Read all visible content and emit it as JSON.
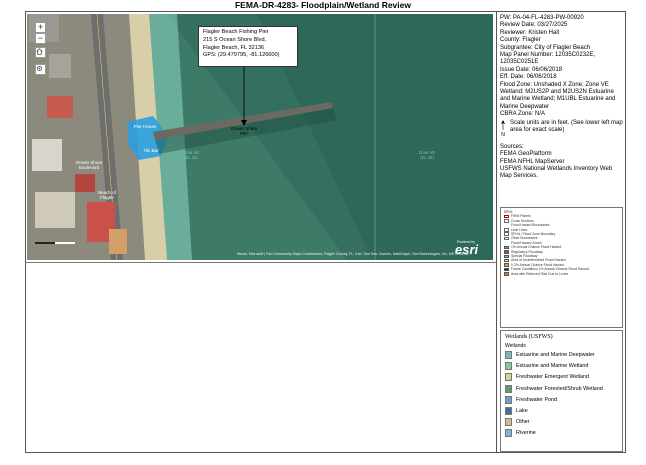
{
  "title": "FEMA-DR-4283- Floodplain/Wetland Review",
  "map": {
    "controls": {
      "zoom_in": "+",
      "zoom_out": "−"
    },
    "callout": {
      "name": "Flagler Beach Fishing Pier",
      "address1": "215 S Ocean Shore Blvd,",
      "address2": "Flagler Beach, FL 32136",
      "gps": "GPS: (29.479795, -81.126600)"
    },
    "labels": {
      "pier_label": "Ocean Shore\nPier",
      "pier_house": "Pier House",
      "tiki": "Tiki Bar",
      "ocean_shore": "Ocean Shore\nBoulevard",
      "beach": "Beach of\nFlagler",
      "zone1": "Zone VE\n(EL 18)",
      "zone2": "Zone VE\n(EL 18)"
    },
    "attribution": "Maxar, Microsoft | Esri Community Maps Contributors, Flagler County, FL, Esri, TomTom, Garmin, SafeGraph, GeoTechnologies, Inc, METI/NASA, USGS, EPA, NPS, US Census Bureau, USDA, USFWS",
    "esri": "esri",
    "powered_by": "Powered by"
  },
  "info": {
    "pw": "PW: PA-04-FL-4283-PW-00920",
    "review_date": "Review Date: 03/27/2025",
    "reviewer": "Reviewer: Kristen Hall",
    "county": "County: Flagler",
    "subgrantee": "Subgrantee: City of Flagler Beach",
    "map_panel": "Map Panel Number: 12035C0232E,",
    "map_panel2": "12035C0251E",
    "issue_date": "Issue Date: 06/06/2018",
    "eff_date": "Eff. Date: 06/06/2018",
    "flood_zone": "Flood Zone: Unshaded X Zone; Zone VE",
    "wetland": "Wetland: M2US2P and M2US2N Estuarine and Marine Wetland; M1UBL Estuarine and Marine Deepwater",
    "cbra": "CBRA Zone: N/A",
    "scale_note": "Scale units are in feet. (See lower left map area for exact scale)",
    "north": "N",
    "sources_head": "Sources:",
    "source1": "FEMA GeoPlatform",
    "source2": "FEMA NFHL MapServer",
    "source3": "USFWS National Wetlands Inventory Web Map Services."
  },
  "legend_nfhl": {
    "title": "NFHL",
    "items": [
      {
        "label": "FIRM Panels",
        "color": "#ffffff",
        "border": "#c00000"
      },
      {
        "label": "Cross Sections",
        "color": "#ffffff",
        "border": "#666666"
      },
      {
        "label": "Flood Hazard Boundaries",
        "color": "#ffffff",
        "border": "#ffffff"
      },
      {
        "label": "Limit Lines",
        "color": "#ffffff",
        "border": "#666666"
      },
      {
        "label": "SFHA / Flood Zone Boundary",
        "color": "#ffffff",
        "border": "#666666"
      },
      {
        "label": "Other Boundaries",
        "color": "#ffffff",
        "border": "#666666"
      },
      {
        "label": "Flood Hazard Zones",
        "color": "#ffffff",
        "border": "#ffffff"
      },
      {
        "label": "1% Annual Chance Flood Hazard",
        "color": "#34a9e1",
        "border": "#555555"
      },
      {
        "label": "Regulatory Floodway",
        "color": "#c0357f",
        "border": "#555555"
      },
      {
        "label": "Special Floodway",
        "color": "#6fb6e8",
        "border": "#555555"
      },
      {
        "label": "Area of Undetermined Flood Hazard",
        "color": "#f3e4a5",
        "border": "#555555"
      },
      {
        "label": "0.2% Annual Chance Flood Hazard",
        "color": "#f29b3d",
        "border": "#555555"
      },
      {
        "label": "Future Conditions 1% Annual Chance Flood Hazard",
        "color": "#2a2a2a",
        "border": "#555555"
      },
      {
        "label": "Area with Reduced Risk Due to Levee",
        "color": "#d9792c",
        "border": "#555555"
      }
    ]
  },
  "legend_wetlands": {
    "title": "Wetlands (USFWS)",
    "subtitle": "Wetlands",
    "items": [
      {
        "label": "Estuarine and Marine Deepwater",
        "color": "#79b8b0"
      },
      {
        "label": "Estuarine and Marine Wetland",
        "color": "#8bc2a8"
      },
      {
        "label": "Freshwater Emergent Wetland",
        "color": "#c4dd86"
      },
      {
        "label": "Freshwater Forested/Shrub Wetland",
        "color": "#5c9e6a"
      },
      {
        "label": "Freshwater Pond",
        "color": "#6e9fc4"
      },
      {
        "label": "Lake",
        "color": "#3b6fa6"
      },
      {
        "label": "Other",
        "color": "#d9b98e"
      },
      {
        "label": "Riverine",
        "color": "#7fb2d9"
      }
    ]
  },
  "colors": {
    "ocean": "#3f7d6b",
    "wetland_shade": "#2f6a5a",
    "building_blue": "#2a9ee0",
    "road": "#7b7b7b",
    "sand": "#d8cfa9"
  }
}
